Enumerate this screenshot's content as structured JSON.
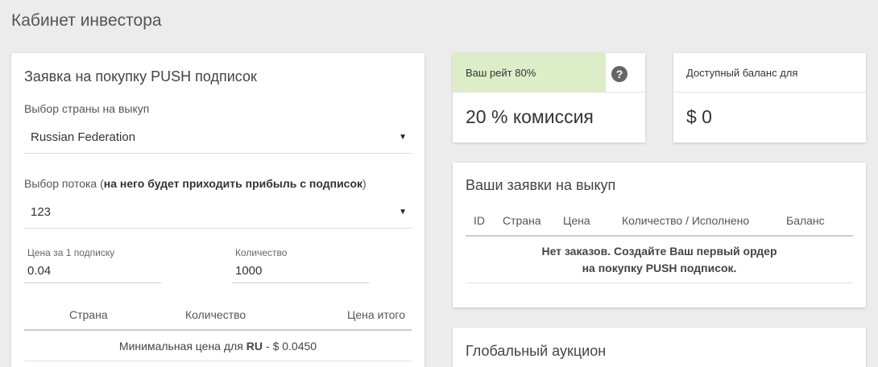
{
  "page": {
    "title": "Кабинет инвестора"
  },
  "order_form": {
    "title": "Заявка на покупку PUSH подписок",
    "country_label": "Выбор страны на выкуп",
    "country_value": "Russian Federation",
    "stream_label_prefix": "Выбор потока (",
    "stream_label_bold": "на него будет приходить прибыль с подписок",
    "stream_label_suffix": ")",
    "stream_value": "123",
    "price_label": "Цена за 1 подписку",
    "price_value": "0.04",
    "quantity_label": "Количество",
    "quantity_value": "1000",
    "table_headers": [
      "Страна",
      "Количество",
      "Цена итого"
    ],
    "min_price_prefix": "Минимальная цена для",
    "min_price_country": "RU",
    "min_price_suffix": "- $ 0.0450"
  },
  "rate_card": {
    "title": "Ваш рейт 80%",
    "help_icon": "question-circle-icon",
    "help_glyph": "?",
    "value": "20 % комиссия"
  },
  "balance_card": {
    "title": "Доступный баланс для",
    "value": "$ 0"
  },
  "my_orders": {
    "title": "Ваши заявки на выкуп",
    "headers": [
      "ID",
      "Страна",
      "Цена",
      "Количество / Исполнено",
      "Баланс"
    ],
    "empty_text": "Нет заказов. Создайте Ваш первый ордер на покупку PUSH подписок."
  },
  "auction": {
    "title": "Глобальный аукцион"
  },
  "colors": {
    "rate_highlight": "#dcedc8",
    "background": "#ececec"
  }
}
